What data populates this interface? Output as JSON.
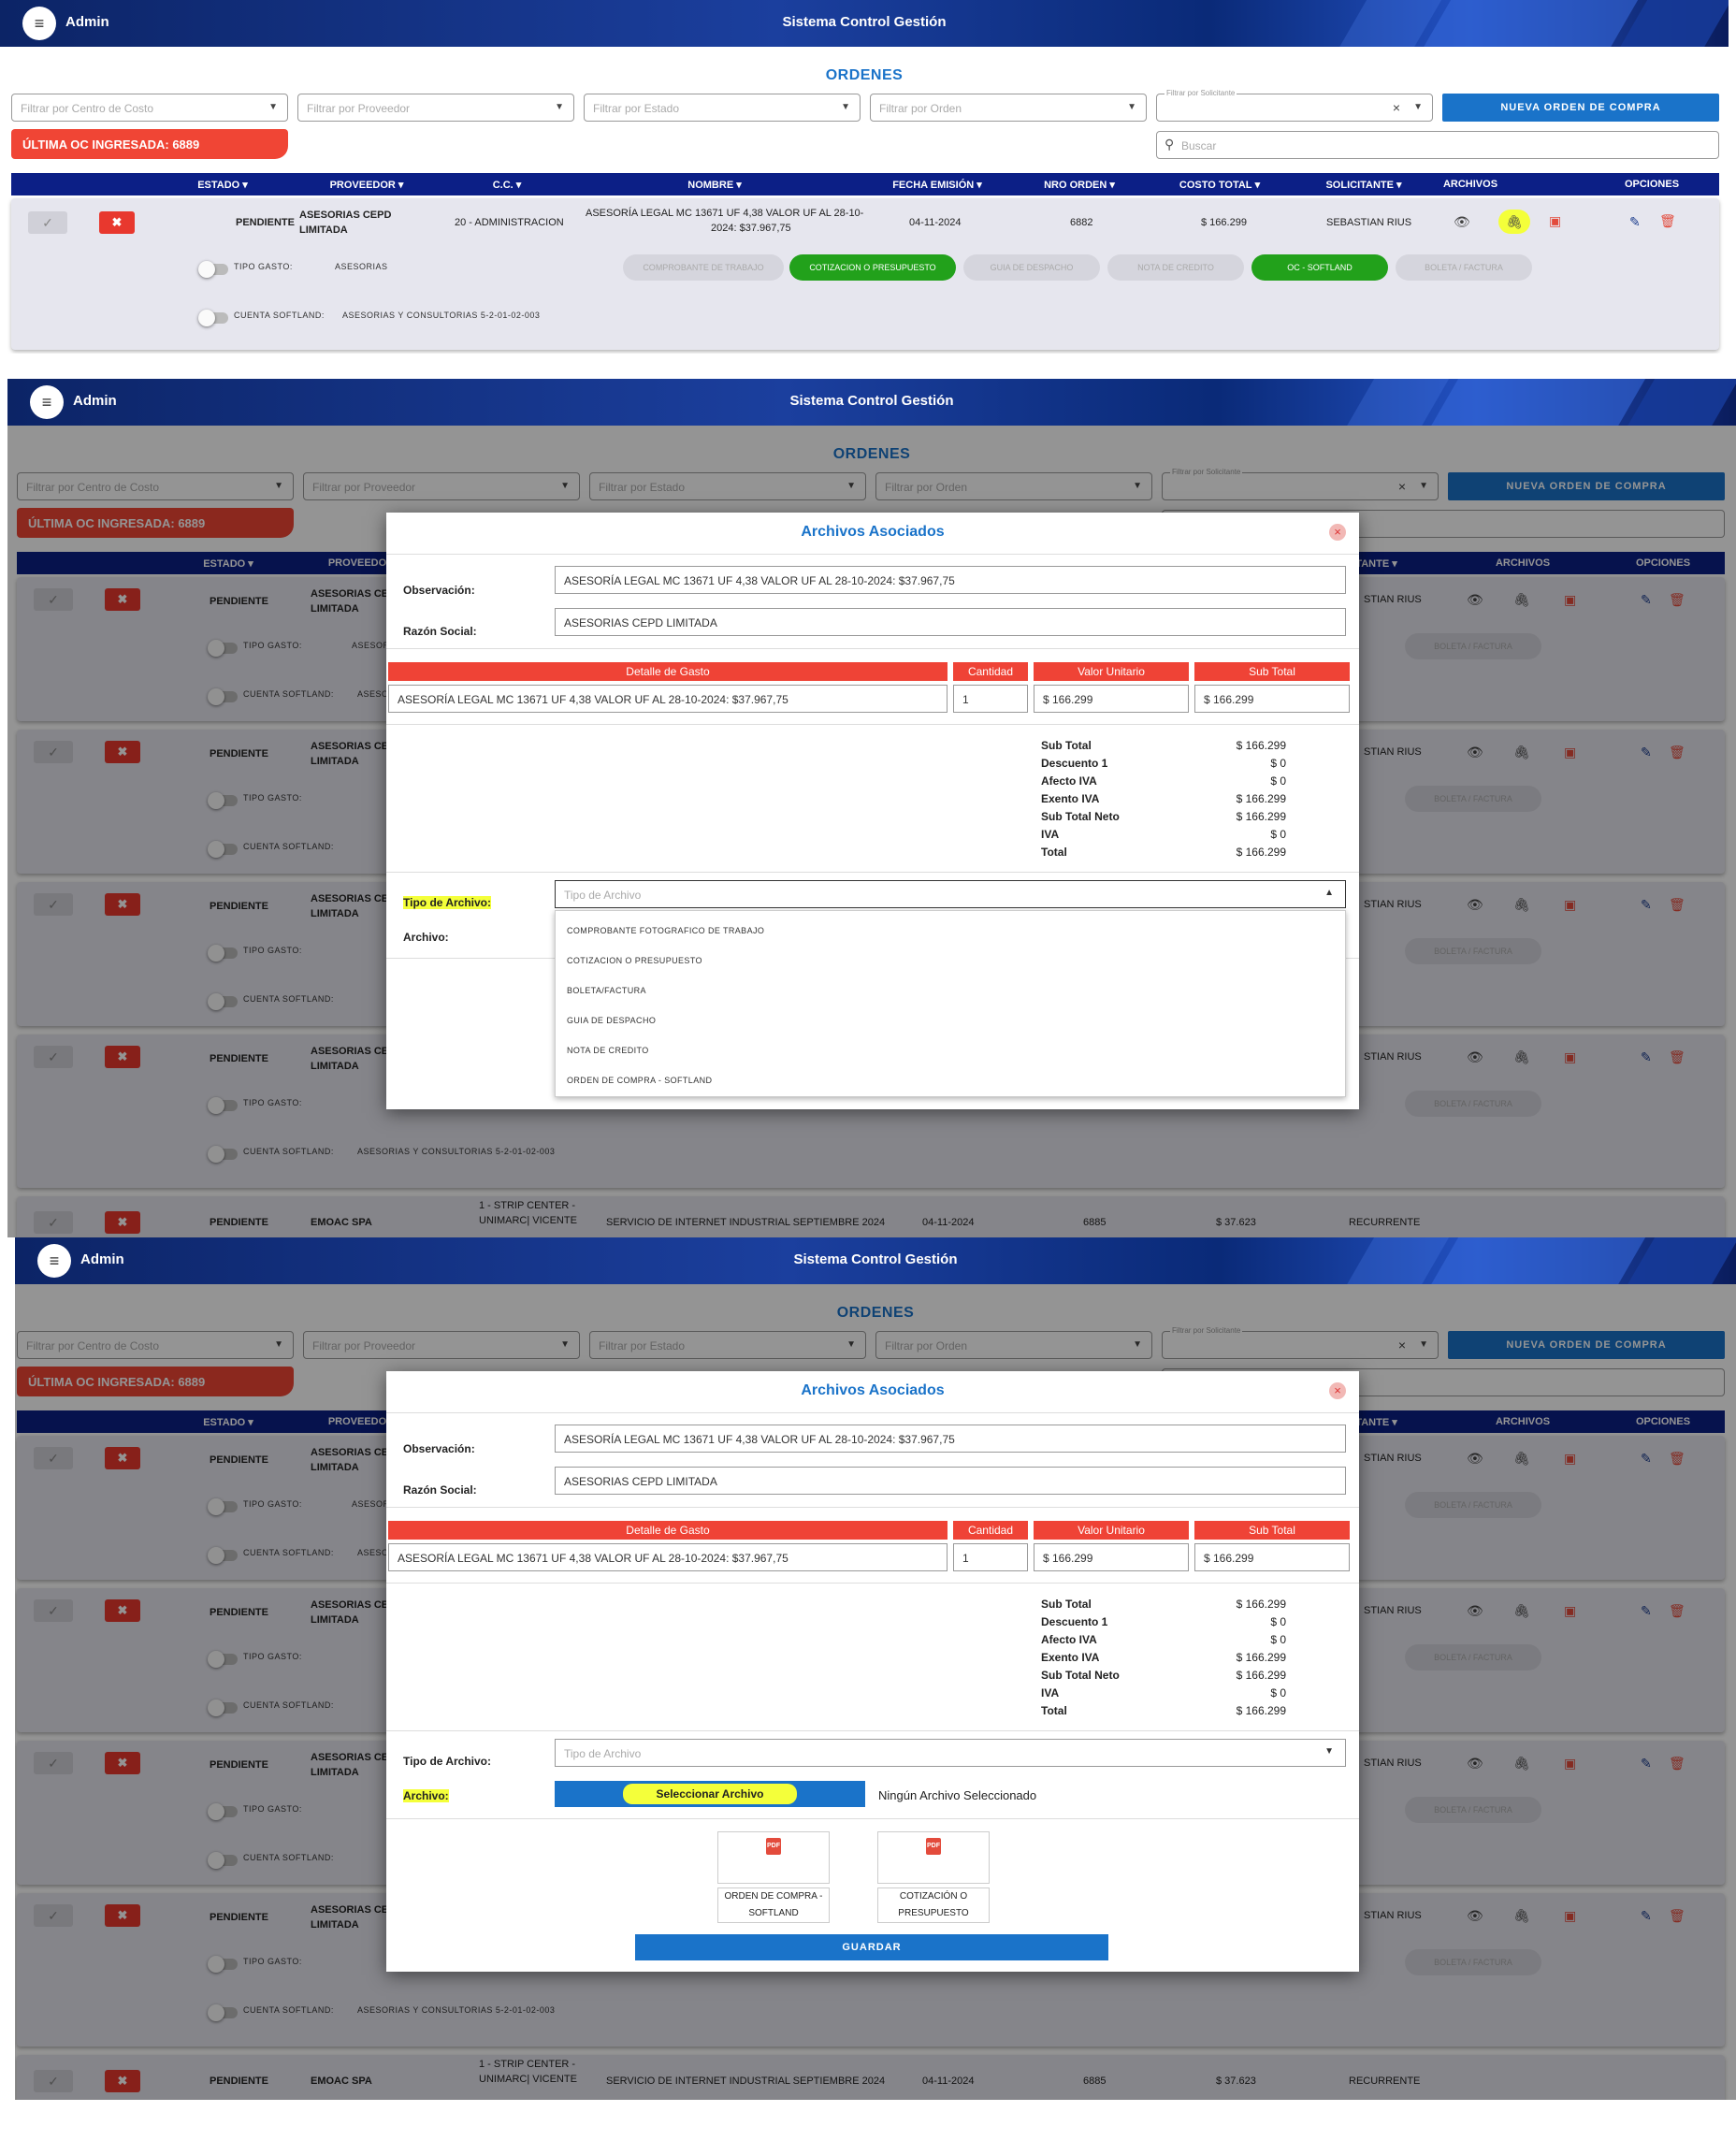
{
  "header": {
    "user": "Admin",
    "title": "Sistema Control Gestión"
  },
  "page_title": "ORDENES",
  "filters": {
    "centro_costo": "Filtrar por Centro de Costo",
    "proveedor": "Filtrar por Proveedor",
    "estado": "Filtrar por Estado",
    "orden": "Filtrar por Orden",
    "solicitante": "Filtrar por Solicitante",
    "search": "Buscar",
    "new_order": "NUEVA ORDEN DE COMPRA"
  },
  "last_oc": "ÚLTIMA OC INGRESADA: 6889",
  "columns": [
    "ESTADO",
    "PROVEEDOR",
    "C.C.",
    "NOMBRE",
    "FECHA EMISIÓN",
    "NRO ORDEN",
    "COSTO TOTAL",
    "SOLICITANTE",
    "ARCHIVOS",
    "OPCIONES"
  ],
  "order": {
    "estado": "PENDIENTE",
    "proveedor_1": "ASESORIAS CEPD",
    "proveedor_2": "LIMITADA",
    "cc": "20 - ADMINISTRACION",
    "nombre_1": "ASESORÍA LEGAL MC 13671 UF 4,38 VALOR UF AL 28-10-",
    "nombre_2": "2024: $37.967,75",
    "fecha": "04-11-2024",
    "nro": "6882",
    "costo": "$ 166.299",
    "solicitante": "SEBASTIAN RIUS",
    "tipo_gasto_label": "TIPO GASTO:",
    "tipo_gasto": "ASESORIAS",
    "cuenta_label": "CUENTA SOFTLAND:",
    "cuenta": "ASESORIAS Y CONSULTORIAS 5-2-01-02-003",
    "pills": [
      "COMPROBANTE DE TRABAJO",
      "COTIZACION O PRESUPUESTO",
      "GUIA DE DESPACHO",
      "NOTA DE CREDITO",
      "OC - SOFTLAND",
      "BOLETA / FACTURA"
    ]
  },
  "bg_rows": {
    "proveedor_short": "ASESORIAS CEP",
    "limitada": "LIMITADA",
    "asesori": "ASESORI",
    "ases": "ASESO",
    "solic_short": "STIAN RIUS",
    "col_solic_short": "ITANTE",
    "col_prov_short": "PROVEEDO",
    "boleta": "BOLETA / FACTURA",
    "cuenta_full": "ASESORIAS Y CONSULTORIAS 5-2-01-02-003",
    "last": {
      "estado": "PENDIENTE",
      "proveedor": "EMOAC SPA",
      "cc_1": "1 - STRIP CENTER -",
      "cc_2": "UNIMARC| VICENTE",
      "nombre": "SERVICIO DE INTERNET INDUSTRIAL SEPTIEMBRE 2024",
      "fecha": "04-11-2024",
      "nro": "6885",
      "costo": "$ 37.623",
      "solicitante": "RECURRENTE"
    }
  },
  "modal": {
    "title": "Archivos Asociados",
    "obs_label": "Observación:",
    "obs": "ASESORÍA LEGAL MC 13671 UF 4,38 VALOR UF AL 28-10-2024: $37.967,75",
    "razon_label": "Razón Social:",
    "razon": "ASESORIAS CEPD LIMITADA",
    "heads": [
      "Detalle de Gasto",
      "Cantidad",
      "Valor Unitario",
      "Sub Total"
    ],
    "detalle": "ASESORÍA LEGAL MC 13671 UF 4,38 VALOR UF AL 28-10-2024: $37.967,75",
    "cantidad": "1",
    "valor": "$ 166.299",
    "subtotal": "$ 166.299",
    "totals": [
      {
        "k": "Sub Total",
        "v": "$ 166.299"
      },
      {
        "k": "Descuento 1",
        "v": "$ 0"
      },
      {
        "k": "Afecto IVA",
        "v": "$ 0"
      },
      {
        "k": "Exento IVA",
        "v": "$ 166.299"
      },
      {
        "k": "Sub Total Neto",
        "v": "$ 166.299"
      },
      {
        "k": "IVA",
        "v": "$ 0"
      },
      {
        "k": "Total",
        "v": "$ 166.299"
      }
    ],
    "tipo_label": "Tipo de Archivo:",
    "tipo_placeholder": "Tipo de Archivo",
    "archivo_label": "Archivo:",
    "options": [
      "COMPROBANTE FOTOGRAFICO DE TRABAJO",
      "COTIZACION O PRESUPUESTO",
      "BOLETA/FACTURA",
      "GUIA DE DESPACHO",
      "NOTA DE CREDITO",
      "ORDEN DE COMPRA - SOFTLAND"
    ],
    "select_file": "Seleccionar Archivo",
    "no_file": "Ningún Archivo Seleccionado",
    "files": [
      {
        "l1": "ORDEN DE COMPRA -",
        "l2": "SOFTLAND"
      },
      {
        "l1": "COTIZACIÓN O",
        "l2": "PRESUPUESTO"
      }
    ],
    "pdf_icon": "PDF",
    "save": "GUARDAR"
  },
  "icons": {
    "menu": "≡",
    "check": "✓",
    "x": "✖",
    "eye": "👁",
    "clip": "🖇",
    "pdf": "▣",
    "edit": "✎",
    "trash": "🗑",
    "search": "⚲",
    "close": "×"
  }
}
